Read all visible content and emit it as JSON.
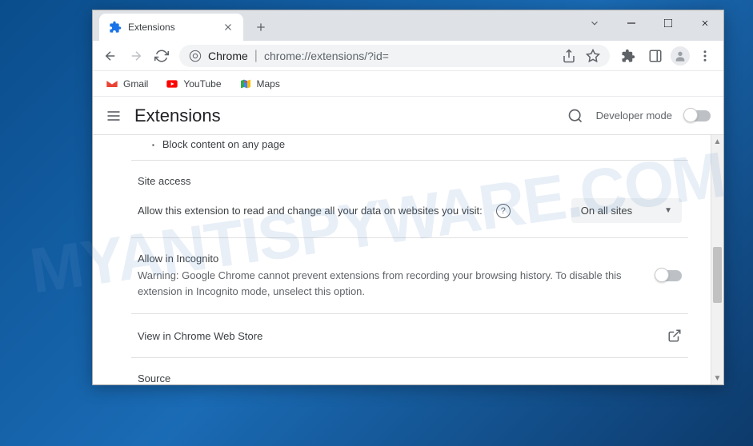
{
  "watermark": "MYANTISPYWARE.COM",
  "tab": {
    "title": "Extensions"
  },
  "addressbar": {
    "scheme_label": "Chrome",
    "path": "chrome://extensions/?id="
  },
  "bookmarks": {
    "gmail": "Gmail",
    "youtube": "YouTube",
    "maps": "Maps"
  },
  "ext_header": {
    "title": "Extensions",
    "dev_mode": "Developer mode"
  },
  "content": {
    "permission_item": "Block content on any page",
    "site_access": {
      "title": "Site access",
      "description": "Allow this extension to read and change all your data on websites you visit:",
      "dropdown_value": "On all sites"
    },
    "incognito": {
      "title": "Allow in Incognito",
      "warning": "Warning: Google Chrome cannot prevent extensions from recording your browsing history. To disable this extension in Incognito mode, unselect this option."
    },
    "webstore": "View in Chrome Web Store",
    "source": "Source"
  }
}
